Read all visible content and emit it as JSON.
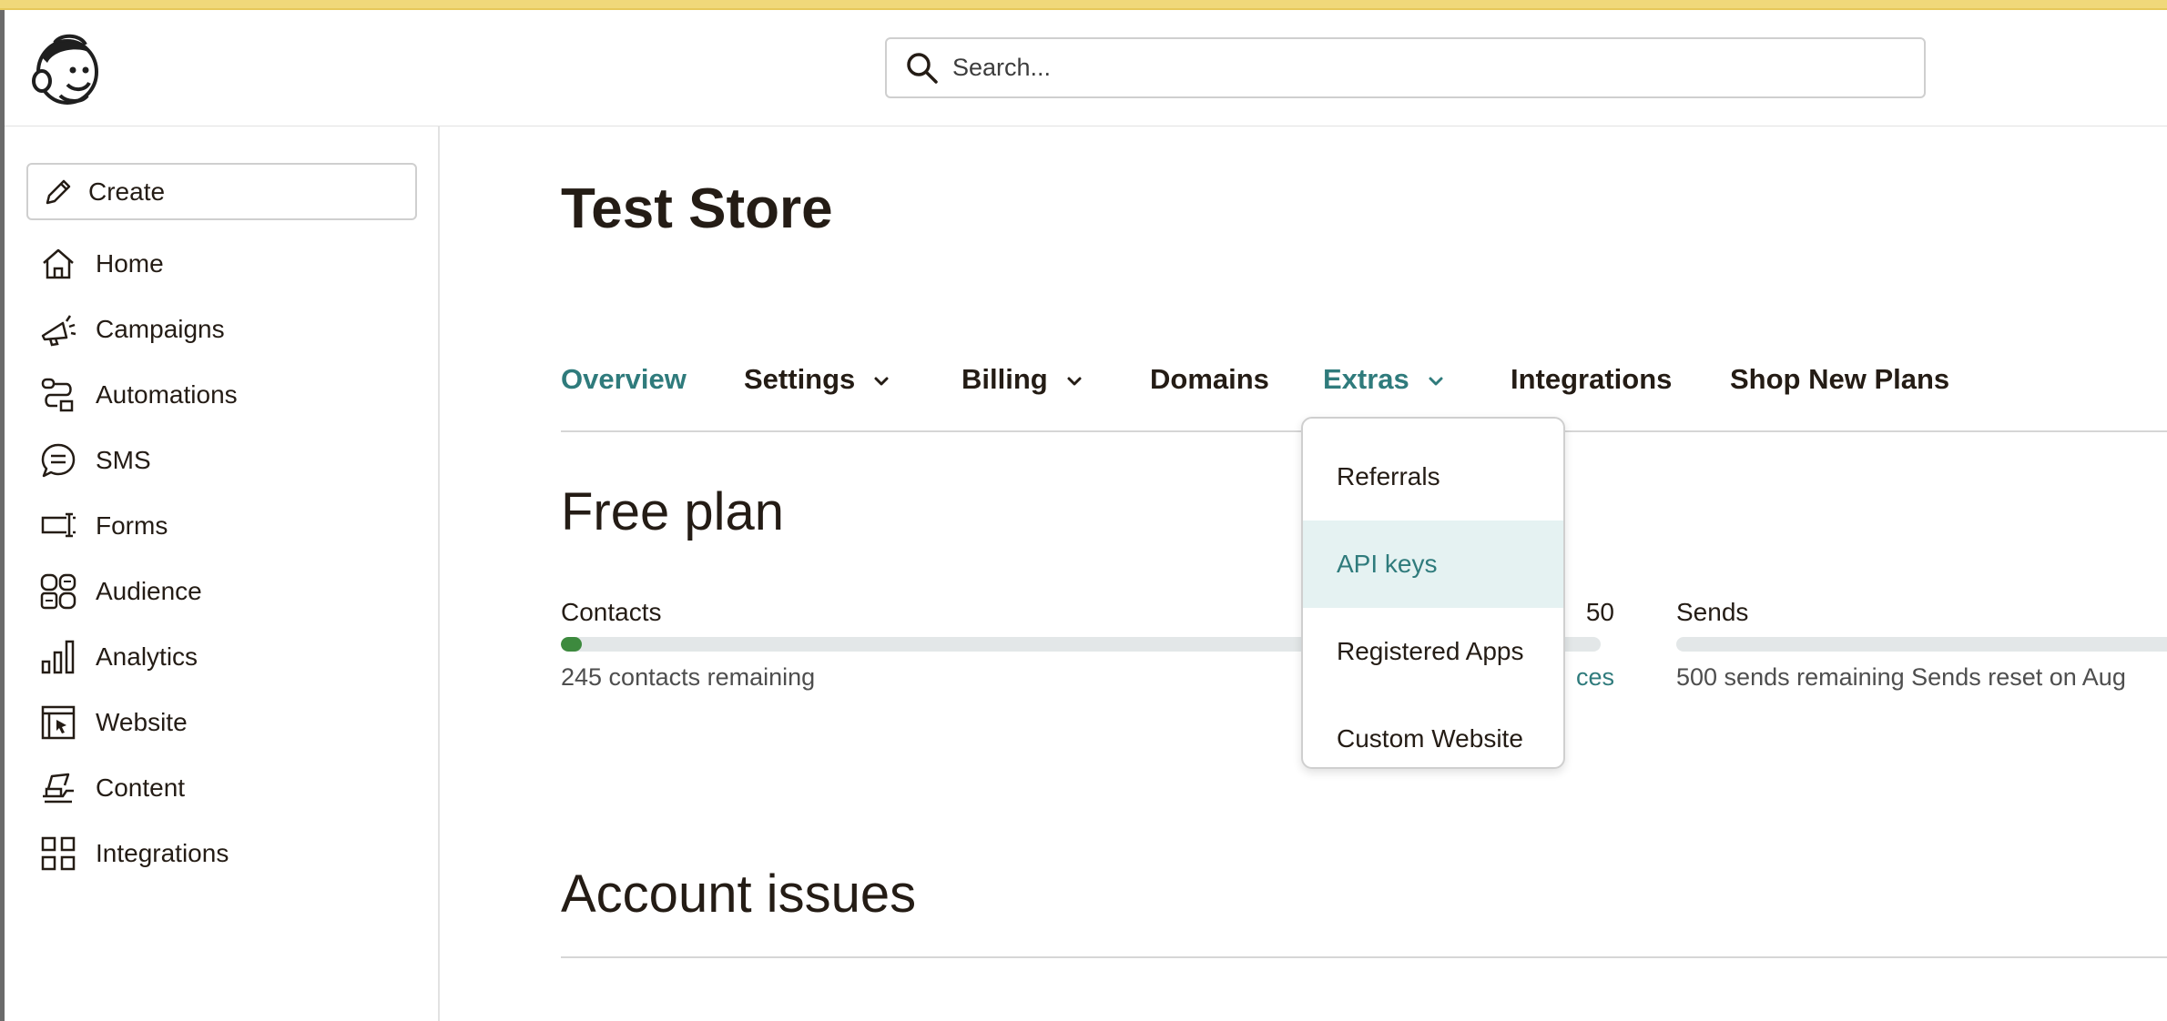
{
  "header": {
    "search": {
      "placeholder": "Search..."
    }
  },
  "sidebar": {
    "create_label": "Create",
    "items": [
      {
        "label": "Home",
        "icon": "home-icon"
      },
      {
        "label": "Campaigns",
        "icon": "megaphone-icon"
      },
      {
        "label": "Automations",
        "icon": "automations-icon"
      },
      {
        "label": "SMS",
        "icon": "sms-icon"
      },
      {
        "label": "Forms",
        "icon": "forms-icon"
      },
      {
        "label": "Audience",
        "icon": "audience-icon"
      },
      {
        "label": "Analytics",
        "icon": "analytics-icon"
      },
      {
        "label": "Website",
        "icon": "website-icon"
      },
      {
        "label": "Content",
        "icon": "content-icon"
      },
      {
        "label": "Integrations",
        "icon": "integrations-icon"
      }
    ]
  },
  "main": {
    "title": "Test Store",
    "tabs": [
      {
        "label": "Overview"
      },
      {
        "label": "Settings"
      },
      {
        "label": "Billing"
      },
      {
        "label": "Domains"
      },
      {
        "label": "Extras"
      },
      {
        "label": "Integrations"
      },
      {
        "label": "Shop New Plans"
      }
    ],
    "plan_title": "Free plan",
    "contacts": {
      "label": "Contacts",
      "limit_partial": "50",
      "remaining": "245 contacts remaining",
      "link_partial": "ces",
      "fill_fraction": 0.02
    },
    "sends": {
      "label": "Sends",
      "remaining": "500 sends remaining Sends reset on Aug",
      "fill_fraction": 0
    },
    "account_issues_title": "Account issues"
  },
  "extras_menu": {
    "items": [
      {
        "label": "Referrals"
      },
      {
        "label": "API keys"
      },
      {
        "label": "Registered Apps"
      },
      {
        "label": "Custom Website"
      }
    ]
  },
  "colors": {
    "accent": "#2f7b7c",
    "progress": "#3d8a3e",
    "highlight_bg": "#e5f2f2",
    "top_strip": "#f0d87a"
  }
}
